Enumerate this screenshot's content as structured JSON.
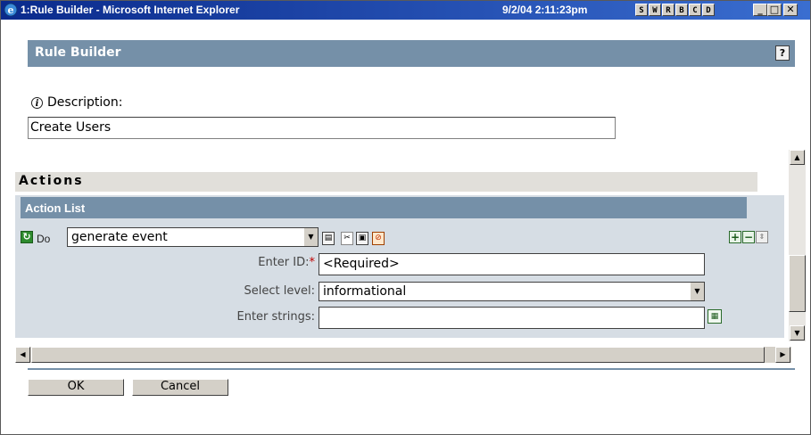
{
  "window": {
    "title": "1:Rule Builder - Microsoft Internet Explorer",
    "timestamp": "9/2/04 2:11:23pm",
    "toolbar_buttons": [
      "S",
      "W",
      "R",
      "B",
      "C",
      "D"
    ],
    "controls": {
      "minimize": "_",
      "maximize": "□",
      "close": "✕"
    }
  },
  "header": {
    "title": "Rule Builder",
    "help_label": "?"
  },
  "description": {
    "label": "Description:",
    "value": "Create Users",
    "info_icon": "i"
  },
  "actions": {
    "section_title": "Actions",
    "list_title": "Action List",
    "do_label": "Do",
    "selected_action": "generate event",
    "fields": [
      {
        "label": "Enter ID:",
        "required_mark": "*",
        "value": "<Required>"
      },
      {
        "label": "Select level:",
        "value": "informational"
      },
      {
        "label": "Enter strings:",
        "value": ""
      }
    ]
  },
  "buttons": {
    "ok": "OK",
    "cancel": "Cancel"
  },
  "colors": {
    "title_bar": "#0a2a8c",
    "section_header": "#7590a8",
    "action_panel": "#d6dde4",
    "actions_bar": "#e1dfda"
  }
}
